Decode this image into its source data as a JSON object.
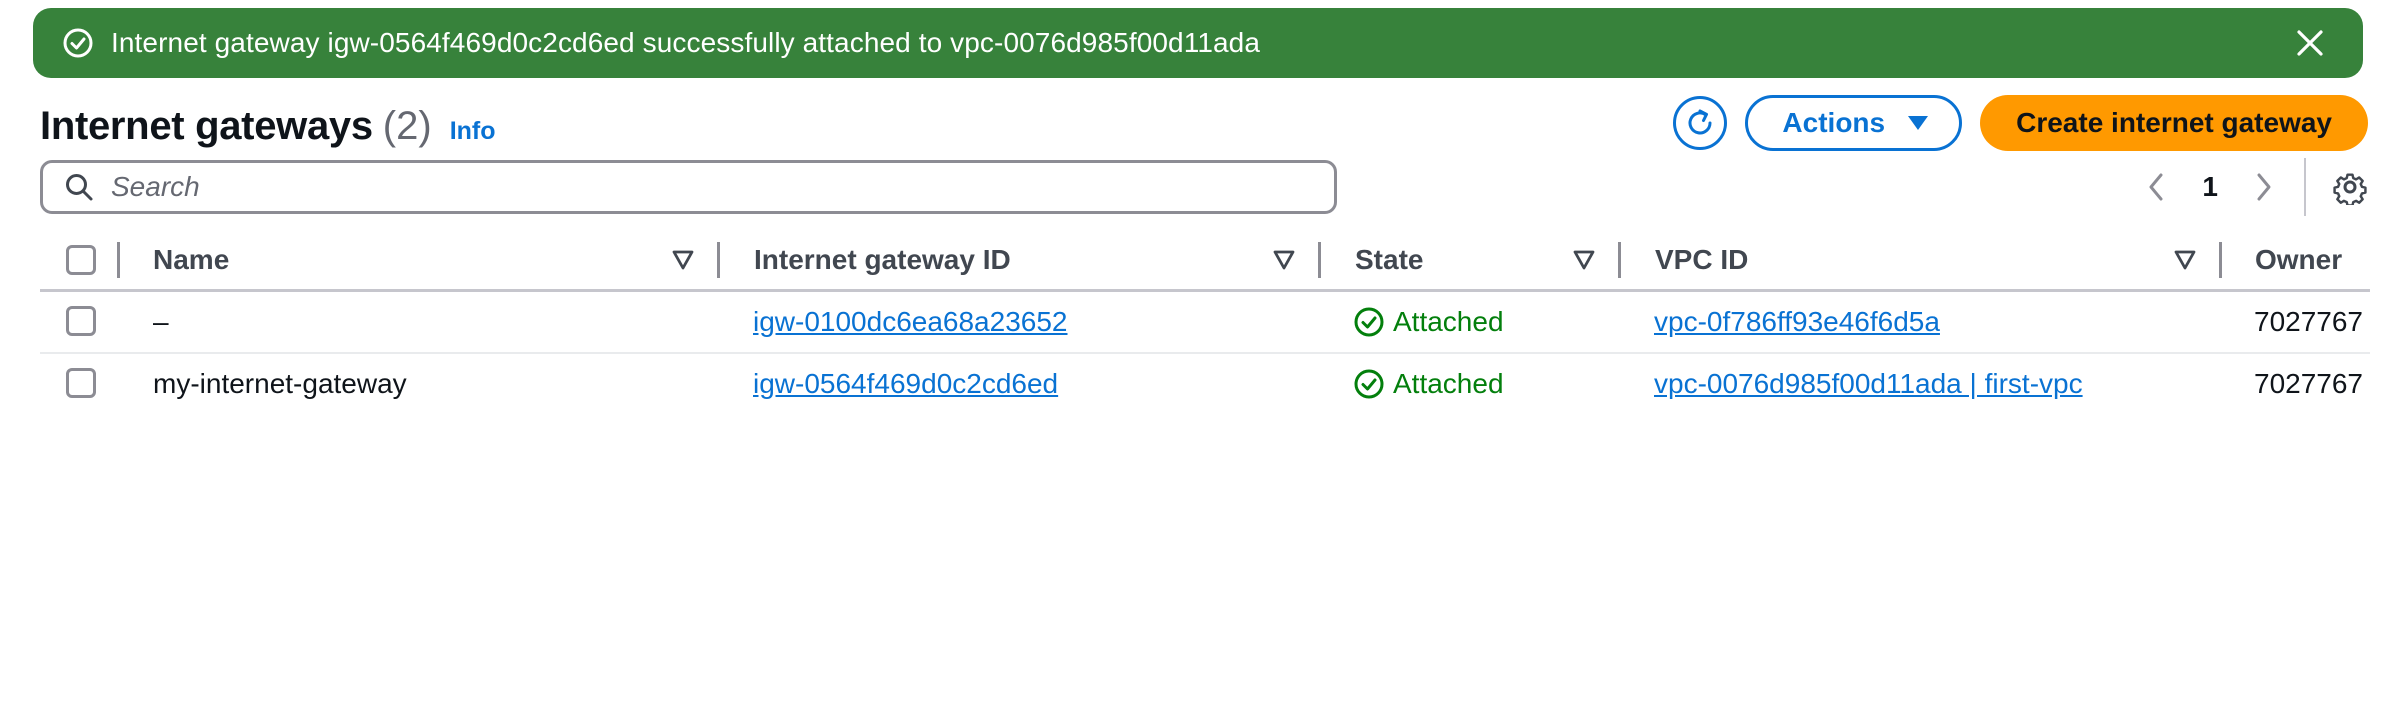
{
  "flash": {
    "message": "Internet gateway igw-0564f469d0c2cd6ed successfully attached to vpc-0076d985f00d11ada",
    "icon": "check-circle-icon",
    "close_icon": "close-icon",
    "background": "#37823b"
  },
  "header": {
    "title": "Internet gateways",
    "count": "(2)",
    "info": "Info"
  },
  "actions": {
    "refresh_icon": "refresh-icon",
    "actions_label": "Actions",
    "create_label": "Create internet gateway",
    "accent": "#0972d3",
    "primary": "#ff9900"
  },
  "search": {
    "placeholder": "Search",
    "value": ""
  },
  "pagination": {
    "current_page": "1"
  },
  "table": {
    "columns": [
      "Name",
      "Internet gateway ID",
      "State",
      "VPC ID",
      "Owner"
    ],
    "rows": [
      {
        "name": "–",
        "igw_id": "igw-0100dc6ea68a23652",
        "state": "Attached",
        "vpc_id": "vpc-0f786ff93e46f6d5a",
        "owner": "7027767"
      },
      {
        "name": "my-internet-gateway",
        "igw_id": "igw-0564f469d0c2cd6ed",
        "state": "Attached",
        "vpc_id": "vpc-0076d985f00d11ada | first-vpc",
        "owner": "7027767"
      }
    ],
    "state_color": "#037f0c"
  }
}
